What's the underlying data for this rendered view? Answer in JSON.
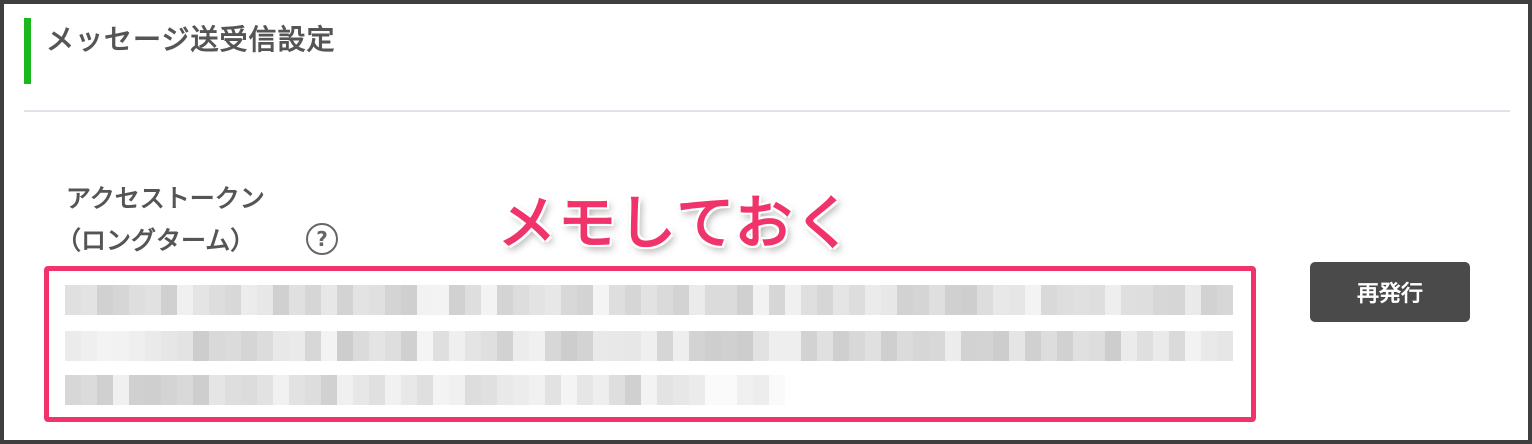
{
  "section": {
    "title": "メッセージ送受信設定",
    "accent_color": "#1bb71f"
  },
  "field": {
    "label_line1": "アクセストークン",
    "label_line2": "（ロングターム）",
    "help_icon": "question-circle-icon",
    "help_glyph": "?"
  },
  "annotation": {
    "text": "メモしておく",
    "color": "#f0346b"
  },
  "token": {
    "state": "blurred",
    "highlight_color": "#f0346b"
  },
  "buttons": {
    "reissue_label": "再発行"
  }
}
